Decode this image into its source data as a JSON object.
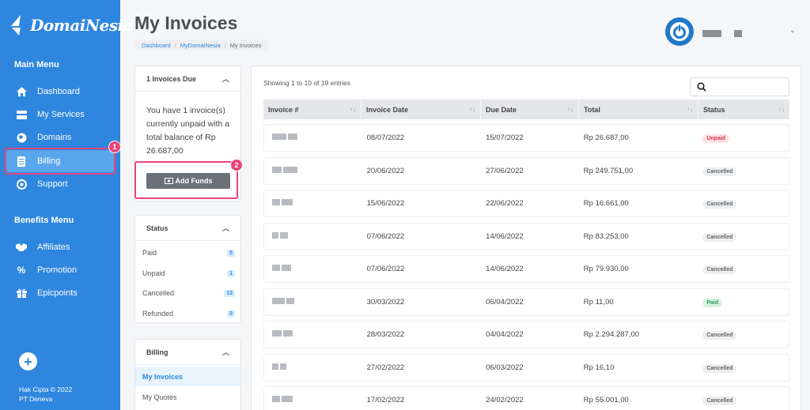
{
  "brand": {
    "name": "DomaiNesia",
    "accent": "#2e86de",
    "highlight": "#e8457a"
  },
  "sidebar": {
    "main_menu_title": "Main Menu",
    "main_items": [
      {
        "label": "Dashboard",
        "icon": "home-icon"
      },
      {
        "label": "My Services",
        "icon": "server-icon"
      },
      {
        "label": "Domains",
        "icon": "globe-icon"
      },
      {
        "label": "Billing",
        "icon": "document-icon"
      },
      {
        "label": "Support",
        "icon": "support-icon"
      }
    ],
    "benefits_title": "Benefits Menu",
    "benefit_items": [
      {
        "label": "Affiliates",
        "icon": "handshake-icon"
      },
      {
        "label": "Promotion",
        "icon": "percent-icon"
      },
      {
        "label": "Epicpoints",
        "icon": "gift-icon"
      }
    ],
    "footer_line1": "Hak Cipta © 2022",
    "footer_line2": "PT Deneva"
  },
  "callouts": {
    "one": "1",
    "two": "2"
  },
  "header": {
    "title": "My Invoices",
    "breadcrumb": [
      "Dashboard",
      "MyDomaiNesia",
      "My Invoices"
    ]
  },
  "invoices_due": {
    "title": "1 Invoices Due",
    "text": "You have 1 invoice(s) currently unpaid with a total balance of Rp 26.687,00",
    "button": "Add Funds"
  },
  "status_panel": {
    "title": "Status",
    "items": [
      {
        "label": "Paid",
        "count": "5"
      },
      {
        "label": "Unpaid",
        "count": "1"
      },
      {
        "label": "Cancelled",
        "count": "13"
      },
      {
        "label": "Refunded",
        "count": "0"
      }
    ]
  },
  "billing_panel": {
    "title": "Billing",
    "items": [
      "My Invoices",
      "My Quotes"
    ]
  },
  "table": {
    "entries_text": "Showing 1 to 10 of 19 entries",
    "columns": [
      "Invoice #",
      "Invoice Date",
      "Due Date",
      "Total",
      "Status"
    ],
    "rows": [
      {
        "invoice_date": "08/07/2022",
        "due_date": "15/07/2022",
        "total": "Rp 26.687,00",
        "status": "Unpaid"
      },
      {
        "invoice_date": "20/06/2022",
        "due_date": "27/06/2022",
        "total": "Rp 249.751,00",
        "status": "Cancelled"
      },
      {
        "invoice_date": "15/06/2022",
        "due_date": "22/06/2022",
        "total": "Rp 16.661,00",
        "status": "Cancelled"
      },
      {
        "invoice_date": "07/06/2022",
        "due_date": "14/06/2022",
        "total": "Rp 83.253,00",
        "status": "Cancelled"
      },
      {
        "invoice_date": "07/06/2022",
        "due_date": "14/06/2022",
        "total": "Rp 79.930,00",
        "status": "Cancelled"
      },
      {
        "invoice_date": "30/03/2022",
        "due_date": "06/04/2022",
        "total": "Rp 11,00",
        "status": "Paid"
      },
      {
        "invoice_date": "28/03/2022",
        "due_date": "04/04/2022",
        "total": "Rp 2.294.287,00",
        "status": "Cancelled"
      },
      {
        "invoice_date": "27/02/2022",
        "due_date": "06/03/2022",
        "total": "Rp 16,10",
        "status": "Cancelled"
      },
      {
        "invoice_date": "17/02/2022",
        "due_date": "24/02/2022",
        "total": "Rp 55.001,00",
        "status": "Cancelled"
      }
    ]
  }
}
